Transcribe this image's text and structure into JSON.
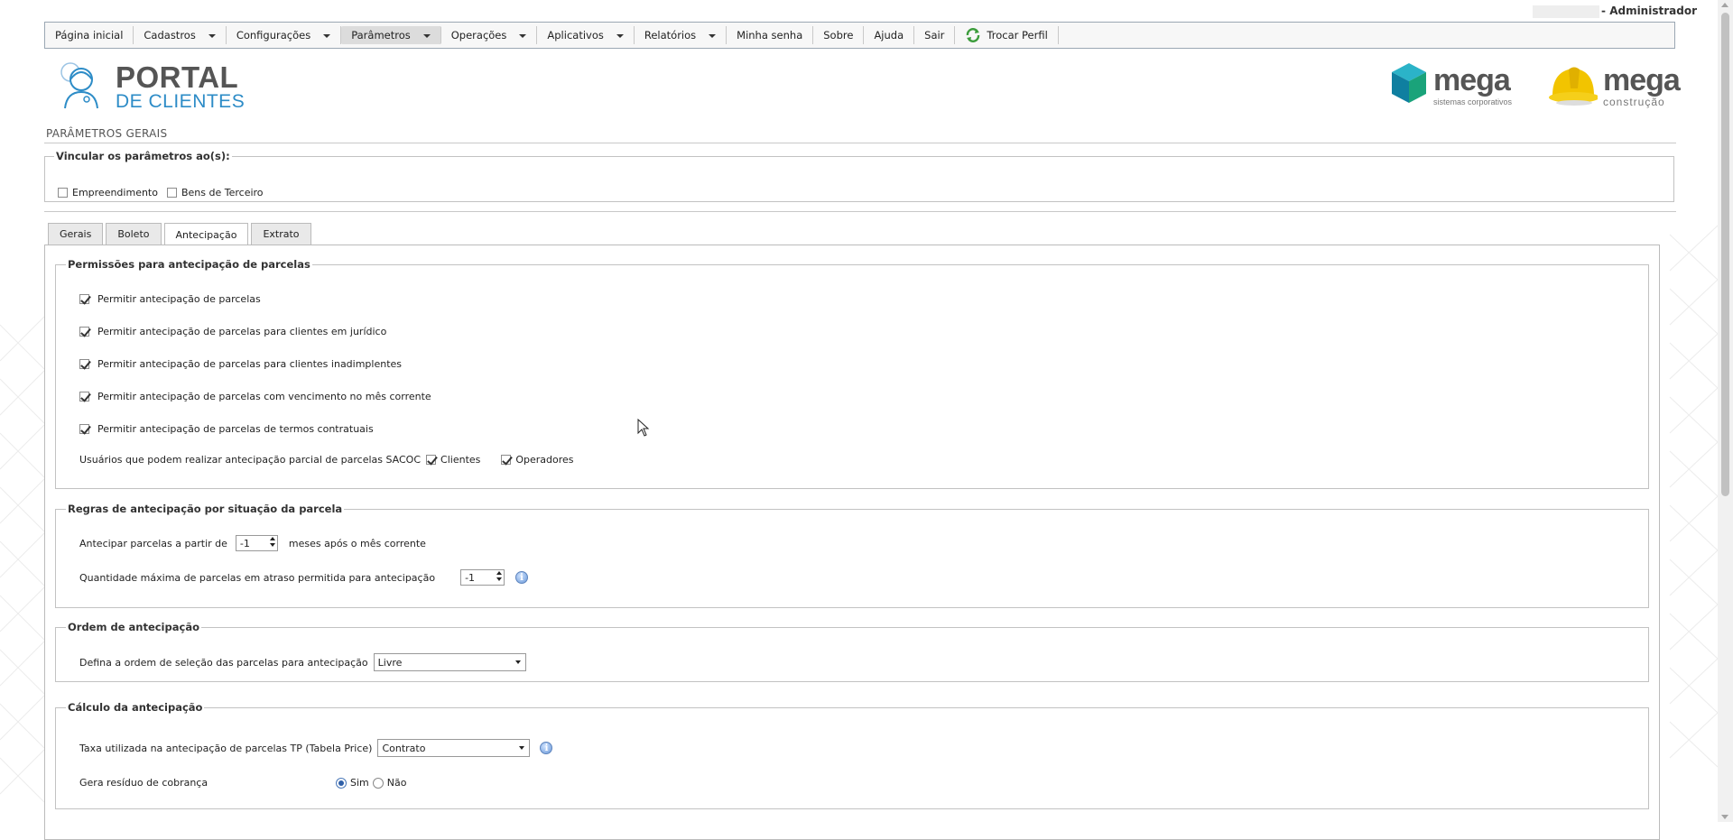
{
  "user": {
    "label": "- Administrador"
  },
  "menu": [
    {
      "label": "Página inicial",
      "dropdown": false
    },
    {
      "label": "Cadastros",
      "dropdown": true
    },
    {
      "label": "Configurações",
      "dropdown": true
    },
    {
      "label": "Parâmetros",
      "dropdown": true,
      "active": true
    },
    {
      "label": "Operações",
      "dropdown": true
    },
    {
      "label": "Aplicativos",
      "dropdown": true
    },
    {
      "label": "Relatórios",
      "dropdown": true
    },
    {
      "label": "Minha senha",
      "dropdown": false
    },
    {
      "label": "Sobre",
      "dropdown": false
    },
    {
      "label": "Ajuda",
      "dropdown": false
    },
    {
      "label": "Sair",
      "dropdown": false
    },
    {
      "label": "Trocar Perfil",
      "dropdown": false,
      "icon": "refresh-icon"
    }
  ],
  "logos": {
    "portal_line1": "PORTAL",
    "portal_line2": "DE CLIENTES",
    "mega1_word": "mega",
    "mega1_sub": "sistemas corporativos",
    "mega2_word": "mega",
    "mega2_sub": "construção",
    "colors": {
      "portal_blue": "#2d8cc7",
      "mega_teal": "#1a9bb0",
      "mega_yellow": "#f2c400"
    }
  },
  "page": {
    "title": "PARÂMETROS GERAIS"
  },
  "vincular": {
    "legend": "Vincular os parâmetros ao(s):",
    "options": [
      {
        "label": "Empreendimento",
        "checked": false
      },
      {
        "label": "Bens de Terceiro",
        "checked": false
      }
    ]
  },
  "tabs": [
    {
      "label": "Gerais",
      "active": false
    },
    {
      "label": "Boleto",
      "active": false
    },
    {
      "label": "Antecipação",
      "active": true
    },
    {
      "label": "Extrato",
      "active": false
    }
  ],
  "permissoes": {
    "legend": "Permissões para antecipação de parcelas",
    "items": [
      {
        "label": "Permitir antecipação de parcelas",
        "checked": true
      },
      {
        "label": "Permitir antecipação de parcelas para clientes em jurídico",
        "checked": true
      },
      {
        "label": "Permitir antecipação de parcelas para clientes inadimplentes",
        "checked": true
      },
      {
        "label": "Permitir antecipação de parcelas com vencimento no mês corrente",
        "checked": true
      },
      {
        "label": "Permitir antecipação de parcelas de termos contratuais",
        "checked": true
      }
    ],
    "parcial_label": "Usuários que podem realizar antecipação parcial de parcelas SACOC",
    "parcial_options": [
      {
        "label": "Clientes",
        "checked": true
      },
      {
        "label": "Operadores",
        "checked": true
      }
    ]
  },
  "regras": {
    "legend": "Regras de antecipação por situação da parcela",
    "row1_prefix": "Antecipar parcelas a partir de",
    "row1_value": "-1",
    "row1_suffix": "meses após o mês corrente",
    "row2_label": "Quantidade máxima de parcelas em atraso permitida para antecipação",
    "row2_value": "-1"
  },
  "ordem": {
    "legend": "Ordem de antecipação",
    "label": "Defina a ordem de seleção das parcelas para antecipação",
    "value": "Livre"
  },
  "calculo": {
    "legend": "Cálculo da antecipação",
    "taxa_label": "Taxa utilizada na antecipação de parcelas TP (Tabela Price)",
    "taxa_value": "Contrato",
    "residuo_label": "Gera resíduo de cobrança",
    "residuo_options": [
      {
        "label": "Sim",
        "selected": true
      },
      {
        "label": "Não",
        "selected": false
      }
    ]
  }
}
